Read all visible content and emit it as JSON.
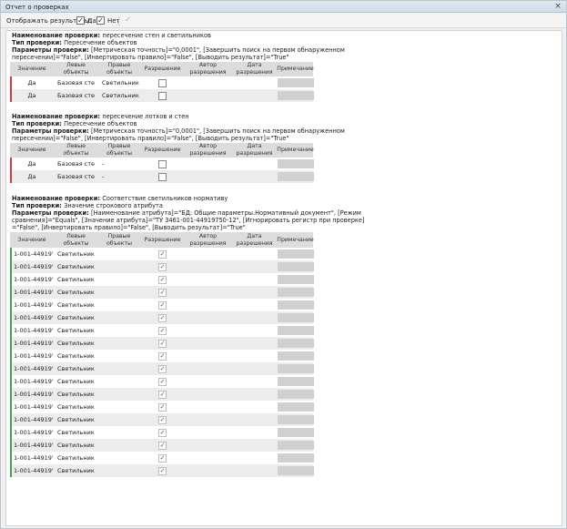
{
  "window": {
    "title": "Отчет о проверках",
    "close_glyph": "×"
  },
  "toolbar": {
    "display_label": "Отображать результаты:",
    "yes_label": "Да",
    "no_label": "Нет",
    "yes_checked": true,
    "no_checked": true,
    "check_glyph": "✓",
    "apply_glyph": "✓"
  },
  "labels": {
    "name": "Наименование проверки:",
    "type": "Тип проверки:",
    "params": "Параметры проверки:"
  },
  "columns": [
    "Значение",
    "Левые объекты",
    "Правые объекты",
    "Разрешение",
    "Автор разрешения",
    "Дата разрешения",
    "Примечание"
  ],
  "sections": [
    {
      "name": "пересечение стен и светильников",
      "type": "Пересечение объектов",
      "params_lines": [
        "[Метрическая точность]=\"0,0001\", [Завершить поиск на первом обнаруженном",
        "пересечении]=\"False\", [Инвертировать правило]=\"False\", [Выводить результат]=\"True\""
      ],
      "rows": [
        {
          "value": "Да",
          "left": "Базовая стен",
          "right": "Светильник",
          "resolved": false
        },
        {
          "value": "Да",
          "left": "Базовая стен",
          "right": "Светильник",
          "resolved": false
        }
      ]
    },
    {
      "name": "пересечение лотков и стен",
      "type": "Пересечение объектов",
      "params_lines": [
        "[Метрическая точность]=\"0,0001\", [Завершить поиск на первом обнаруженном",
        "пересечении]=\"False\", [Инвертировать правило]=\"False\", [Выводить результат]=\"True\""
      ],
      "rows": [
        {
          "value": "Да",
          "left": "Базовая стен",
          "right": "-",
          "resolved": false
        },
        {
          "value": "Да",
          "left": "Базовая стен",
          "right": "-",
          "resolved": false
        }
      ]
    },
    {
      "name": "Соответствие светильников нормативу",
      "type": "Значение строкового атрибута",
      "params_lines": [
        "[Наименование атрибута]=\"БД: Общие параметры.Нормативный документ\", [Режим",
        "сравнения]=\"Equals\", [Значение атрибута]=\"ТУ 3461-001-44919750-12\", [Игнорировать регистр при проверке]",
        "=\"False\", [Инвертировать правило]=\"False\", [Выводить результат]=\"True\""
      ],
      "rows": [
        {
          "value": "1-001-44919'",
          "left": "Светильник",
          "right": "",
          "resolved": true
        },
        {
          "value": "1-001-44919'",
          "left": "Светильник",
          "right": "",
          "resolved": true
        },
        {
          "value": "1-001-44919'",
          "left": "Светильник",
          "right": "",
          "resolved": true
        },
        {
          "value": "1-001-44919'",
          "left": "Светильник",
          "right": "",
          "resolved": true
        },
        {
          "value": "1-001-44919'",
          "left": "Светильник",
          "right": "",
          "resolved": true
        },
        {
          "value": "1-001-44919'",
          "left": "Светильник",
          "right": "",
          "resolved": true
        },
        {
          "value": "1-001-44919'",
          "left": "Светильник",
          "right": "",
          "resolved": true
        },
        {
          "value": "1-001-44919'",
          "left": "Светильник",
          "right": "",
          "resolved": true
        },
        {
          "value": "1-001-44919'",
          "left": "Светильник",
          "right": "",
          "resolved": true
        },
        {
          "value": "1-001-44919'",
          "left": "Светильник",
          "right": "",
          "resolved": true
        },
        {
          "value": "1-001-44919'",
          "left": "Светильник",
          "right": "",
          "resolved": true
        },
        {
          "value": "1-001-44919'",
          "left": "Светильник",
          "right": "",
          "resolved": true
        },
        {
          "value": "1-001-44919'",
          "left": "Светильник",
          "right": "",
          "resolved": true
        },
        {
          "value": "1-001-44919'",
          "left": "Светильник",
          "right": "",
          "resolved": true
        },
        {
          "value": "1-001-44919'",
          "left": "Светильник",
          "right": "",
          "resolved": true
        },
        {
          "value": "1-001-44919'",
          "left": "Светильник",
          "right": "",
          "resolved": true
        },
        {
          "value": "1-001-44919'",
          "left": "Светильник",
          "right": "",
          "resolved": true
        },
        {
          "value": "1-001-44919'",
          "left": "Светильник",
          "right": "",
          "resolved": true
        }
      ]
    }
  ],
  "colors": {
    "unresolved_mark": "#d23c3c",
    "resolved_mark": "#3ea64a",
    "header_bg": "#dcdcdc"
  }
}
